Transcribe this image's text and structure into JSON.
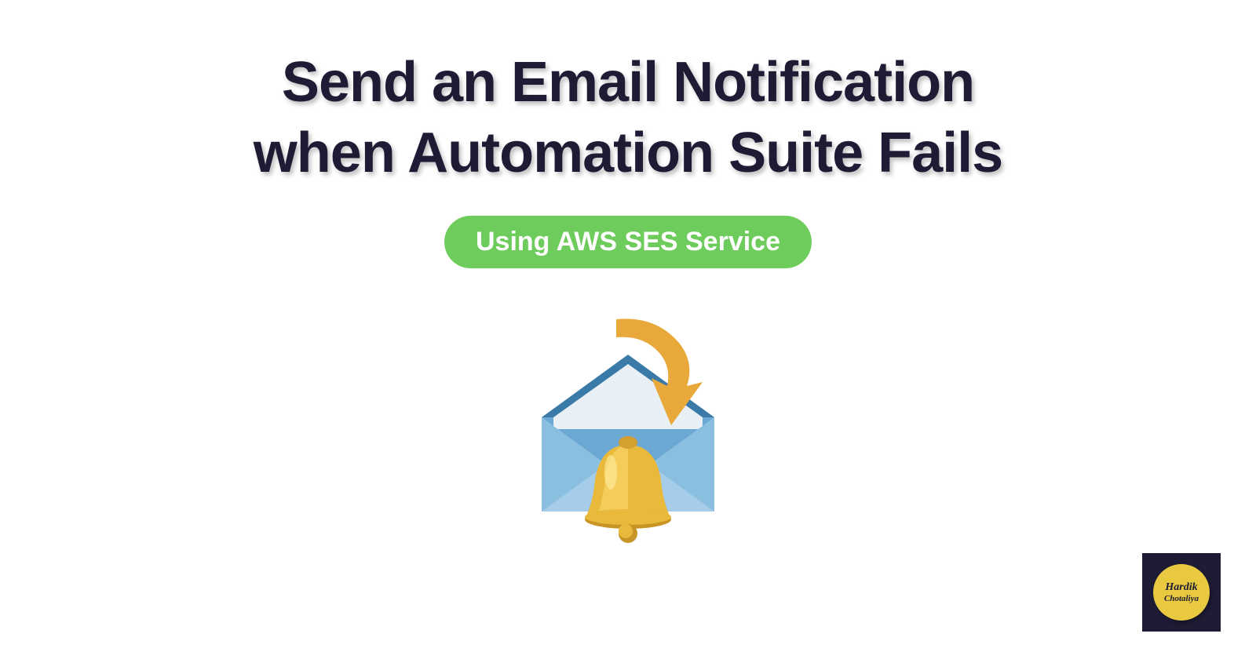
{
  "heading": {
    "line1": "Send an Email Notification",
    "line2": "when Automation Suite Fails"
  },
  "pill_label": "Using AWS SES Service",
  "logo": {
    "name": "Hardik",
    "surname": "Chotaliya"
  }
}
